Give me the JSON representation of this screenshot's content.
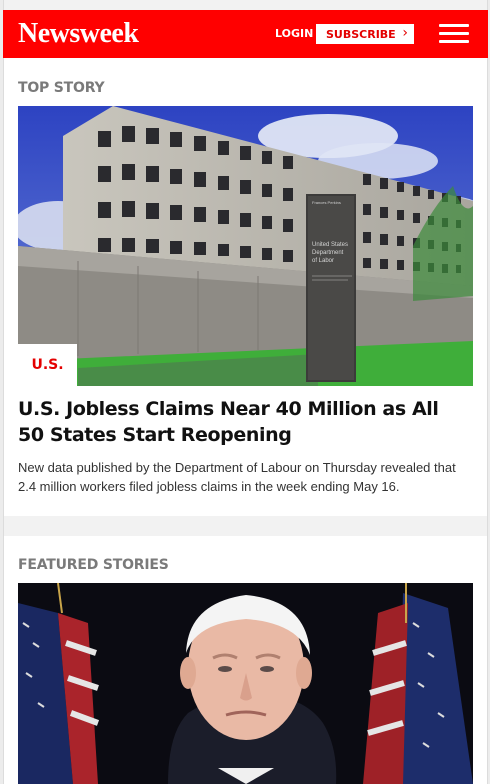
{
  "header": {
    "logo": "Newsweek",
    "login_label": "LOGIN",
    "subscribe_label": "SUBSCRIBE",
    "menu_icon": "hamburger-menu-icon",
    "brand_color": "#ff0000"
  },
  "top_story": {
    "section_label": "TOP STORY",
    "category_tag": "U.S.",
    "headline": "U.S. Jobless Claims Near 40 Million as All 50 States Start Reopening",
    "summary": "New data published by the Department of Labour on Thursday revealed that 2.4 million workers filed jobless claims in the week ending May 16.",
    "sign_text": [
      "United States",
      "Department",
      "of Labor"
    ]
  },
  "featured": {
    "section_label": "FEATURED STORIES"
  }
}
